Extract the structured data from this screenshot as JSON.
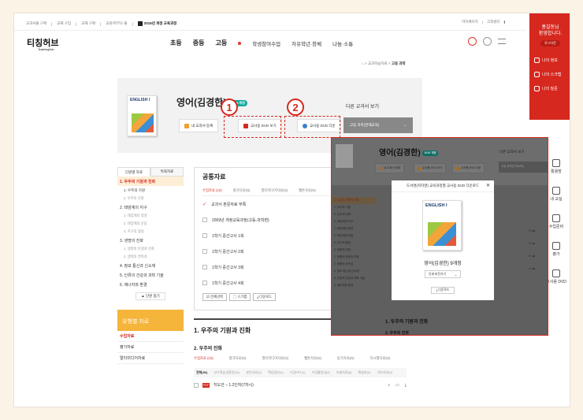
{
  "util": {
    "items": [
      "교과서몰 구매",
      "교재 구입",
      "교재 구매",
      "교원/학부모 몰"
    ],
    "badge": "2015년 개정 교육과정"
  },
  "topright": {
    "items": [
      "마이페이지",
      "고객센터"
    ],
    "sns": "f"
  },
  "logo": {
    "name": "티칭허브",
    "sub": "TeachingHub"
  },
  "gnb": {
    "items": [
      "초등",
      "중등",
      "고등"
    ],
    "sub": [
      "학생참여수업",
      "자유학년·창체",
      "나눔·소통"
    ]
  },
  "red": {
    "greet1": "홍길동님",
    "greet2": "환영합니다.",
    "logout": "로그아웃",
    "menu": [
      "나의 정보",
      "나의 스크랩",
      "나의 질문"
    ]
  },
  "side2": {
    "items": [
      "활용방",
      "내 교실",
      "수업준비",
      "평가",
      "교사용 DVD"
    ]
  },
  "crumb": {
    "path": "⌂ > 교과학습자료 > ",
    "current": "고등 과학"
  },
  "hero": {
    "title": "영어(김경한)",
    "pill": "2015 개정",
    "btn1": "내 교과서 등록",
    "btn2": "교사용 DVD 보기",
    "btn3": "교사용 DVD 다운",
    "other": "다른 교과서 보기",
    "select": "고등 과학(천재교육)",
    "book": "ENGLISH I"
  },
  "callouts": {
    "one": "1",
    "two": "2"
  },
  "lnav": {
    "tab1": "단원별 자료",
    "tab2": "특화자료",
    "items": [
      {
        "t": "1. 우주의 기원과 진화",
        "c": "hl"
      },
      {
        "t": "1. 우주의 기원",
        "c": "subb"
      },
      {
        "t": "2. 우주의 진화",
        "c": "sub"
      },
      {
        "t": "2. 태양계의 지구",
        "c": ""
      },
      {
        "t": "1. 태양계의 형성",
        "c": "sub"
      },
      {
        "t": "2. 태양계의 운동",
        "c": "sub"
      },
      {
        "t": "3. 지구의 형성",
        "c": "sub"
      },
      {
        "t": "3. 생명의 진화",
        "c": ""
      },
      {
        "t": "1. 생명의 탄생과 진화",
        "c": "sub"
      },
      {
        "t": "2. 생명의 연속성",
        "c": "sub"
      },
      {
        "t": "4. 정보 통신과 신소재",
        "c": ""
      },
      {
        "t": "5. 인류의 건강과 과학 기술",
        "c": ""
      },
      {
        "t": "6. 에너지와 환경",
        "c": ""
      }
    ],
    "fold": "▲ 단원 접기",
    "typebox": "유형별 자료",
    "types": [
      "수업자료",
      "평가자료",
      "멀티미디어자료"
    ]
  },
  "main": {
    "title": "공통자료",
    "ftabs": [
      "수업자료 (10)",
      "평가자료(N)",
      "멀티미디어자료(N)",
      "웹툰자료(N)"
    ],
    "rows": [
      "교과서 본문자료 부록",
      "2009년 개정교육과정(고등-과학편)",
      "1학기 중간고사 1회",
      "1학기 중간고사 2회",
      "1학기 중간고사 3회",
      "1학기 중간고사 4회"
    ],
    "btns": [
      "☑ 전체선택",
      "▢ 스크랩",
      "⤓ 다운로드"
    ],
    "sec1": "1. 우주의 기원과 진화",
    "sec2": "2. 우주의 진화",
    "ftabs2": [
      "수업자료 (10)",
      "평가자료(N)",
      "멀티미디어자료(N)",
      "웹툰자료(N)",
      "동기자료(N)",
      "차시별자료(N)"
    ],
    "pills": [
      "전체(50)",
      "교수학습과정안(21)",
      "본문자료(2)",
      "핵심정리(1)",
      "수업PPT(1)",
      "수업활동지(2)",
      "보충자료(6)",
      "해설지(0)",
      "기타자료(0)"
    ],
    "last": "지도안 – 1.2인자(7차시)"
  },
  "overlay": {
    "title": "영어(김경한)",
    "pill": "2015 개정",
    "btn1": "내 교과서 등록",
    "btn2": "교사용 DVD 보기",
    "btn3": "교사용 DVD 다운",
    "other": "다른 교과서 보기",
    "select": "고등 과학(천재교육)",
    "sec": "1. 우주의 기원과 진화",
    "sec2": "2. 우주의 진화"
  },
  "modal": {
    "head": "도서명(저자명) 교육과정별 교사용 DVD 다운로드",
    "close": "✕",
    "book": "ENGLISH I",
    "name": "영어(김경한) 9개정",
    "select": "인쇄 버전가기",
    "download": "⤓ 다운로드"
  }
}
